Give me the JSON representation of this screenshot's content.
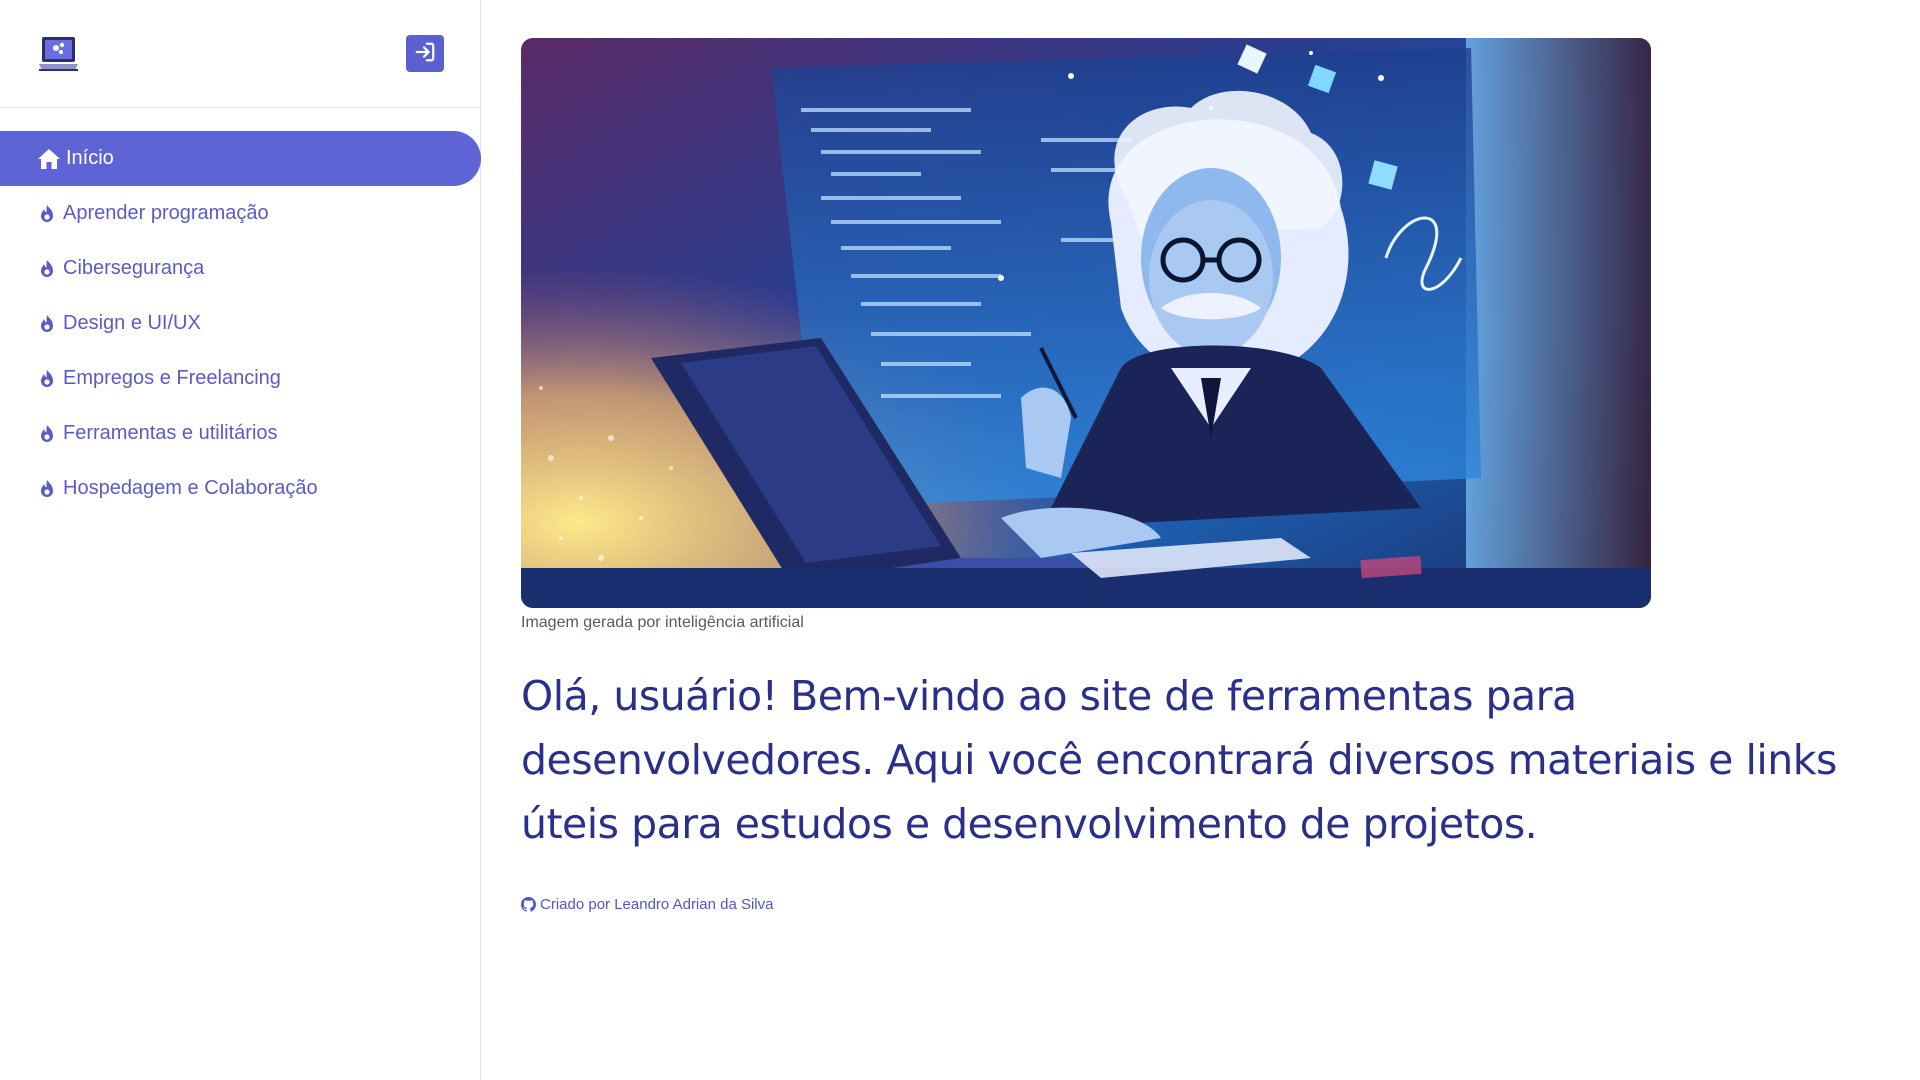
{
  "sidebar": {
    "logo_icon": "laptop-gear-icon",
    "login_icon": "sign-in-icon",
    "items": [
      {
        "label": "Início",
        "icon": "home-icon",
        "active": true
      },
      {
        "label": "Aprender programação",
        "icon": "flame-icon",
        "active": false
      },
      {
        "label": "Cibersegurança",
        "icon": "flame-icon",
        "active": false
      },
      {
        "label": "Design e UI/UX",
        "icon": "flame-icon",
        "active": false
      },
      {
        "label": "Empregos e Freelancing",
        "icon": "flame-icon",
        "active": false
      },
      {
        "label": "Ferramentas e utilitários",
        "icon": "flame-icon",
        "active": false
      },
      {
        "label": "Hospedagem e Colaboração",
        "icon": "flame-icon",
        "active": false
      }
    ]
  },
  "main": {
    "image_caption": "Imagem gerada por inteligência artificial",
    "welcome_text": "Olá, usuário! Bem-vindo ao site de ferramentas para desenvolvedores. Aqui você encontrará diversos materiais e links úteis para estudos e desenvolvimento de projetos.",
    "credits_text": "Criado por Leandro Adrian da Silva",
    "credits_icon": "github-icon"
  },
  "colors": {
    "accent": "#5e63d6",
    "nav_text": "#5a5cc4",
    "heading_text": "#2a2f8a"
  }
}
